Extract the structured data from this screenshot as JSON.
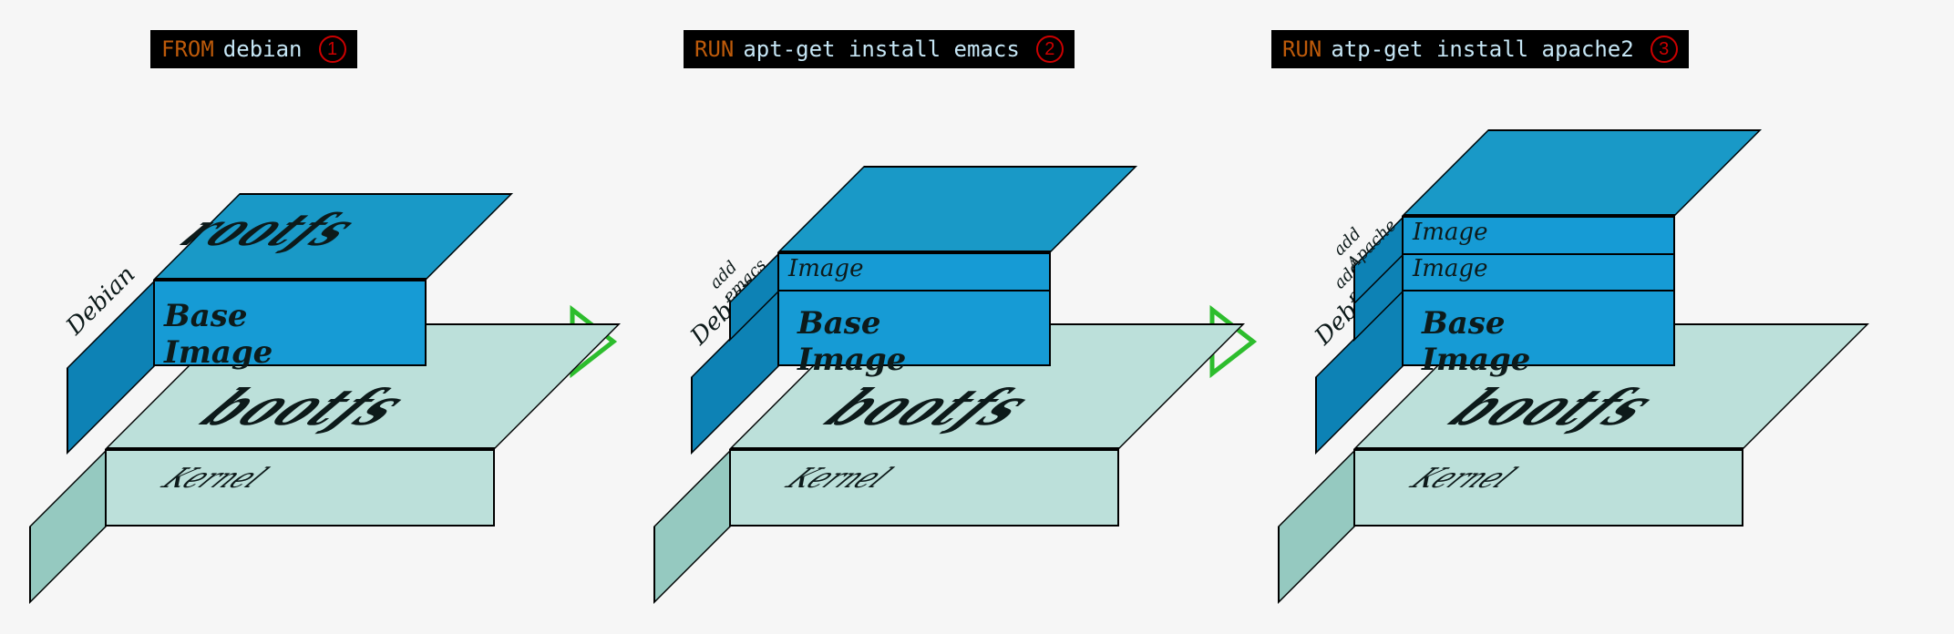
{
  "commands": [
    {
      "kw": "FROM",
      "rest": "debian",
      "num": "1"
    },
    {
      "kw": "RUN",
      "rest": "apt-get install emacs",
      "num": "2"
    },
    {
      "kw": "RUN",
      "rest": "atp-get install apache2",
      "num": "3"
    }
  ],
  "labels": {
    "bootfs": "bootfs",
    "kernel": "Kernel",
    "rootfs": "rootfs",
    "baseImage": "Base Image",
    "debian": "Debian",
    "image": "Image",
    "addEmacs": "add emacs",
    "addApache": "add Apache"
  }
}
